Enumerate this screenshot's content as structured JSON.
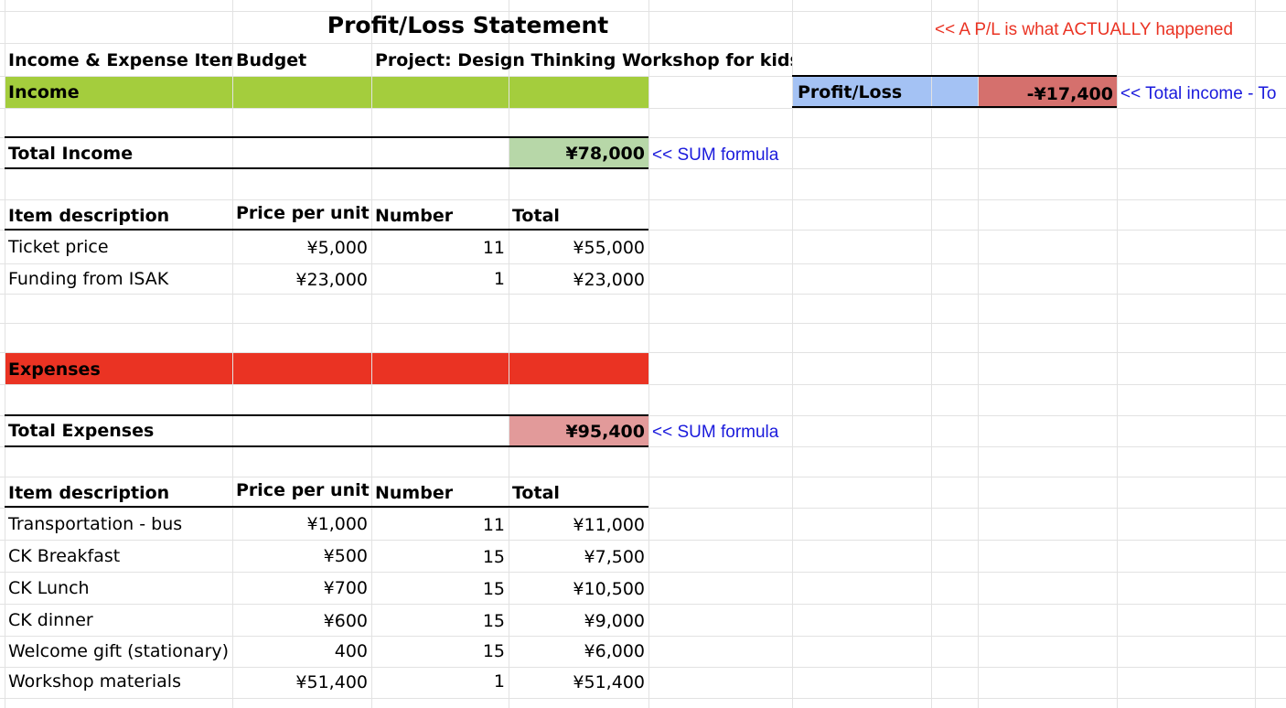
{
  "title": "Profit/Loss Statement",
  "note_top": "<< A P/L is what ACTUALLY happened",
  "header": {
    "col_a": "Income & Expense Items",
    "col_b": "Budget",
    "col_c": "Project: Design Thinking Workshop for kids"
  },
  "pl": {
    "label": "Profit/Loss",
    "value": "-¥17,400",
    "note": "<< Total income - To"
  },
  "income": {
    "section_label": "Income",
    "total_label": "Total Income",
    "total_value": "¥78,000",
    "total_note": "<< SUM formula",
    "columns": [
      "Item description",
      "Price per unit",
      "Number",
      "Total"
    ],
    "items": [
      {
        "desc": "Ticket price",
        "price": "¥5,000",
        "num": "11",
        "total": "¥55,000"
      },
      {
        "desc": "Funding from ISAK",
        "price": "¥23,000",
        "num": "1",
        "total": "¥23,000"
      }
    ]
  },
  "expenses": {
    "section_label": "Expenses",
    "total_label": "Total Expenses",
    "total_value": "¥95,400",
    "total_note": "<< SUM formula",
    "columns": [
      "Item description",
      "Price per unit",
      "Number",
      "Total"
    ],
    "items": [
      {
        "desc": "Transportation - bus",
        "price": "¥1,000",
        "num": "11",
        "total": "¥11,000"
      },
      {
        "desc": "CK Breakfast",
        "price": "¥500",
        "num": "15",
        "total": "¥7,500"
      },
      {
        "desc": "CK Lunch",
        "price": "¥700",
        "num": "15",
        "total": "¥10,500"
      },
      {
        "desc": "CK dinner",
        "price": "¥600",
        "num": "15",
        "total": "¥9,000"
      },
      {
        "desc": "Welcome gift (stationary)",
        "price": "400",
        "num": "15",
        "total": "¥6,000"
      },
      {
        "desc": "Workshop materials",
        "price": "¥51,400",
        "num": "1",
        "total": "¥51,400"
      }
    ]
  },
  "colors": {
    "income_green": "#a4cd3d",
    "total_income_green": "#b7d7a8",
    "expenses_red": "#ea3323",
    "total_expenses_pink": "#e29a9a",
    "pl_blue": "#a4c2f4",
    "pl_red": "#d5706d",
    "note_red": "#ea3323",
    "note_blue": "#1a1adc"
  }
}
